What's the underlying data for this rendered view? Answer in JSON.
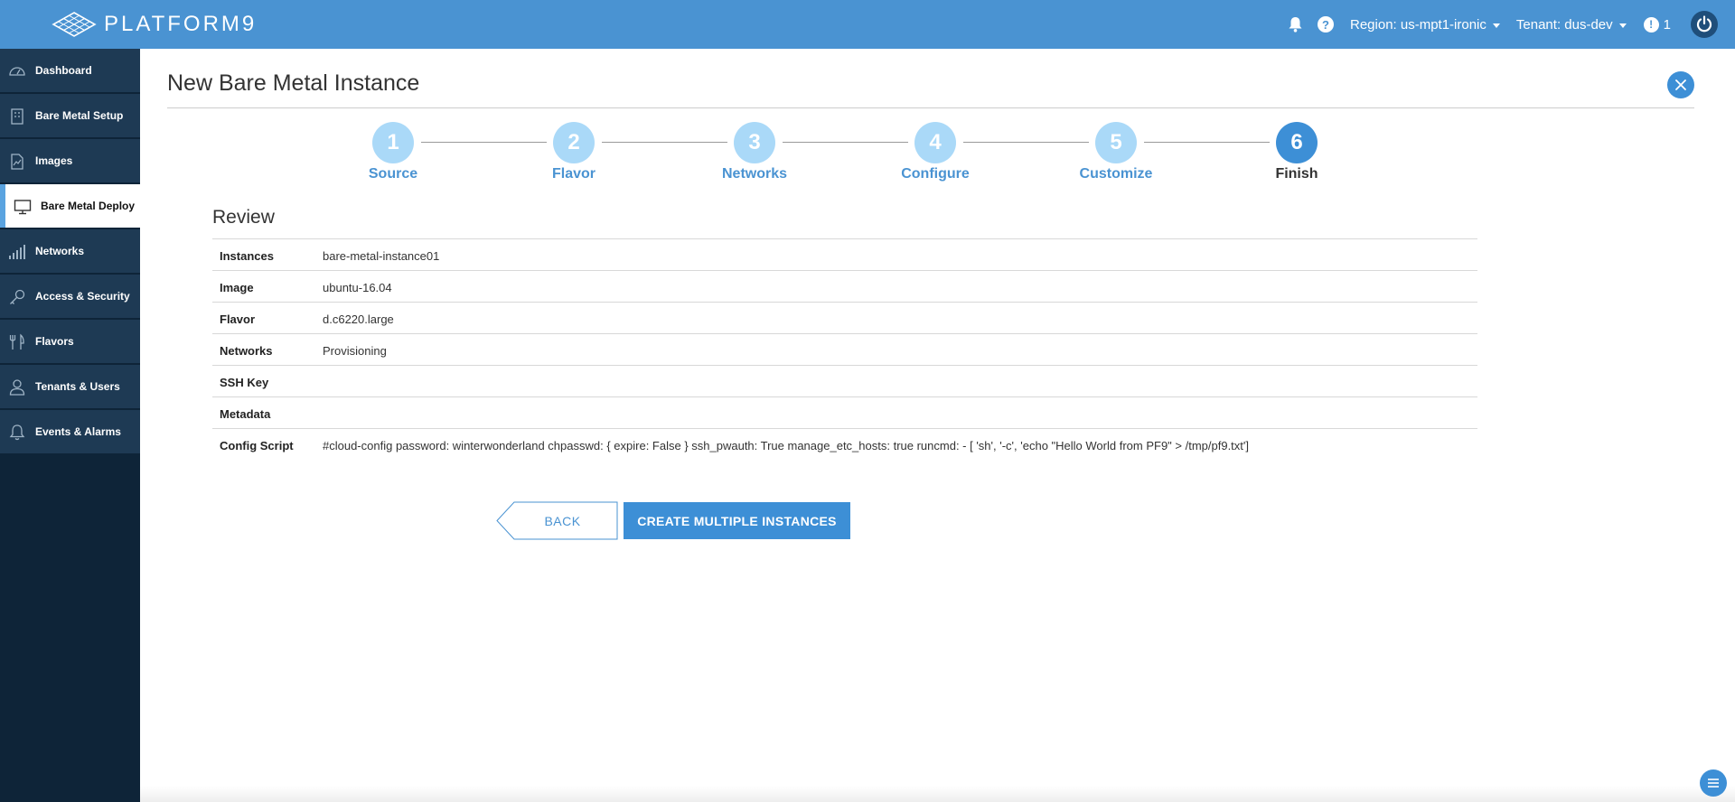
{
  "brand": {
    "name": "PLATFORM9"
  },
  "topbar": {
    "region_label": "Region: us-mpt1-ironic",
    "tenant_label": "Tenant: dus-dev",
    "alerts_count": "1",
    "help_glyph": "?",
    "alert_glyph": "!",
    "icons": [
      "bell-icon",
      "help-icon",
      "alert-icon",
      "power-icon"
    ]
  },
  "sidebar": {
    "items": [
      {
        "label": "Dashboard",
        "icon": "dashboard-icon"
      },
      {
        "label": "Bare Metal Setup",
        "icon": "building-icon"
      },
      {
        "label": "Images",
        "icon": "image-icon"
      },
      {
        "label": "Bare Metal Deploy",
        "icon": "monitor-icon",
        "active": true
      },
      {
        "label": "Networks",
        "icon": "signal-bars-icon"
      },
      {
        "label": "Access & Security",
        "icon": "key-icon"
      },
      {
        "label": "Flavors",
        "icon": "utensils-icon"
      },
      {
        "label": "Tenants & Users",
        "icon": "user-icon"
      },
      {
        "label": "Events & Alarms",
        "icon": "bell-icon"
      }
    ]
  },
  "page": {
    "title": "New Bare Metal Instance"
  },
  "wizard": {
    "steps": [
      {
        "number": "1",
        "label": "Source"
      },
      {
        "number": "2",
        "label": "Flavor"
      },
      {
        "number": "3",
        "label": "Networks"
      },
      {
        "number": "4",
        "label": "Configure"
      },
      {
        "number": "5",
        "label": "Customize"
      },
      {
        "number": "6",
        "label": "Finish"
      }
    ],
    "current_step": 6
  },
  "review": {
    "title": "Review",
    "rows": [
      {
        "key": "Instances",
        "value": "bare-metal-instance01"
      },
      {
        "key": "Image",
        "value": "ubuntu-16.04"
      },
      {
        "key": "Flavor",
        "value": "d.c6220.large"
      },
      {
        "key": "Networks",
        "value": "Provisioning"
      },
      {
        "key": "SSH Key",
        "value": ""
      },
      {
        "key": "Metadata",
        "value": ""
      },
      {
        "key": "Config Script",
        "value": "#cloud-config password: winterwonderland chpasswd: { expire: False } ssh_pwauth: True manage_etc_hosts: true runcmd: - [ 'sh', '-c', 'echo \"Hello World from PF9\" > /tmp/pf9.txt']"
      }
    ]
  },
  "actions": {
    "back_label": "BACK",
    "create_label": "CREATE MULTIPLE INSTANCES"
  },
  "colors": {
    "topbar": "#4a93d2",
    "sidebar_bg": "#0e2438",
    "sidebar_item": "#1e3a54",
    "accent": "#3d8fd6",
    "step_inactive": "#aad9f8"
  }
}
